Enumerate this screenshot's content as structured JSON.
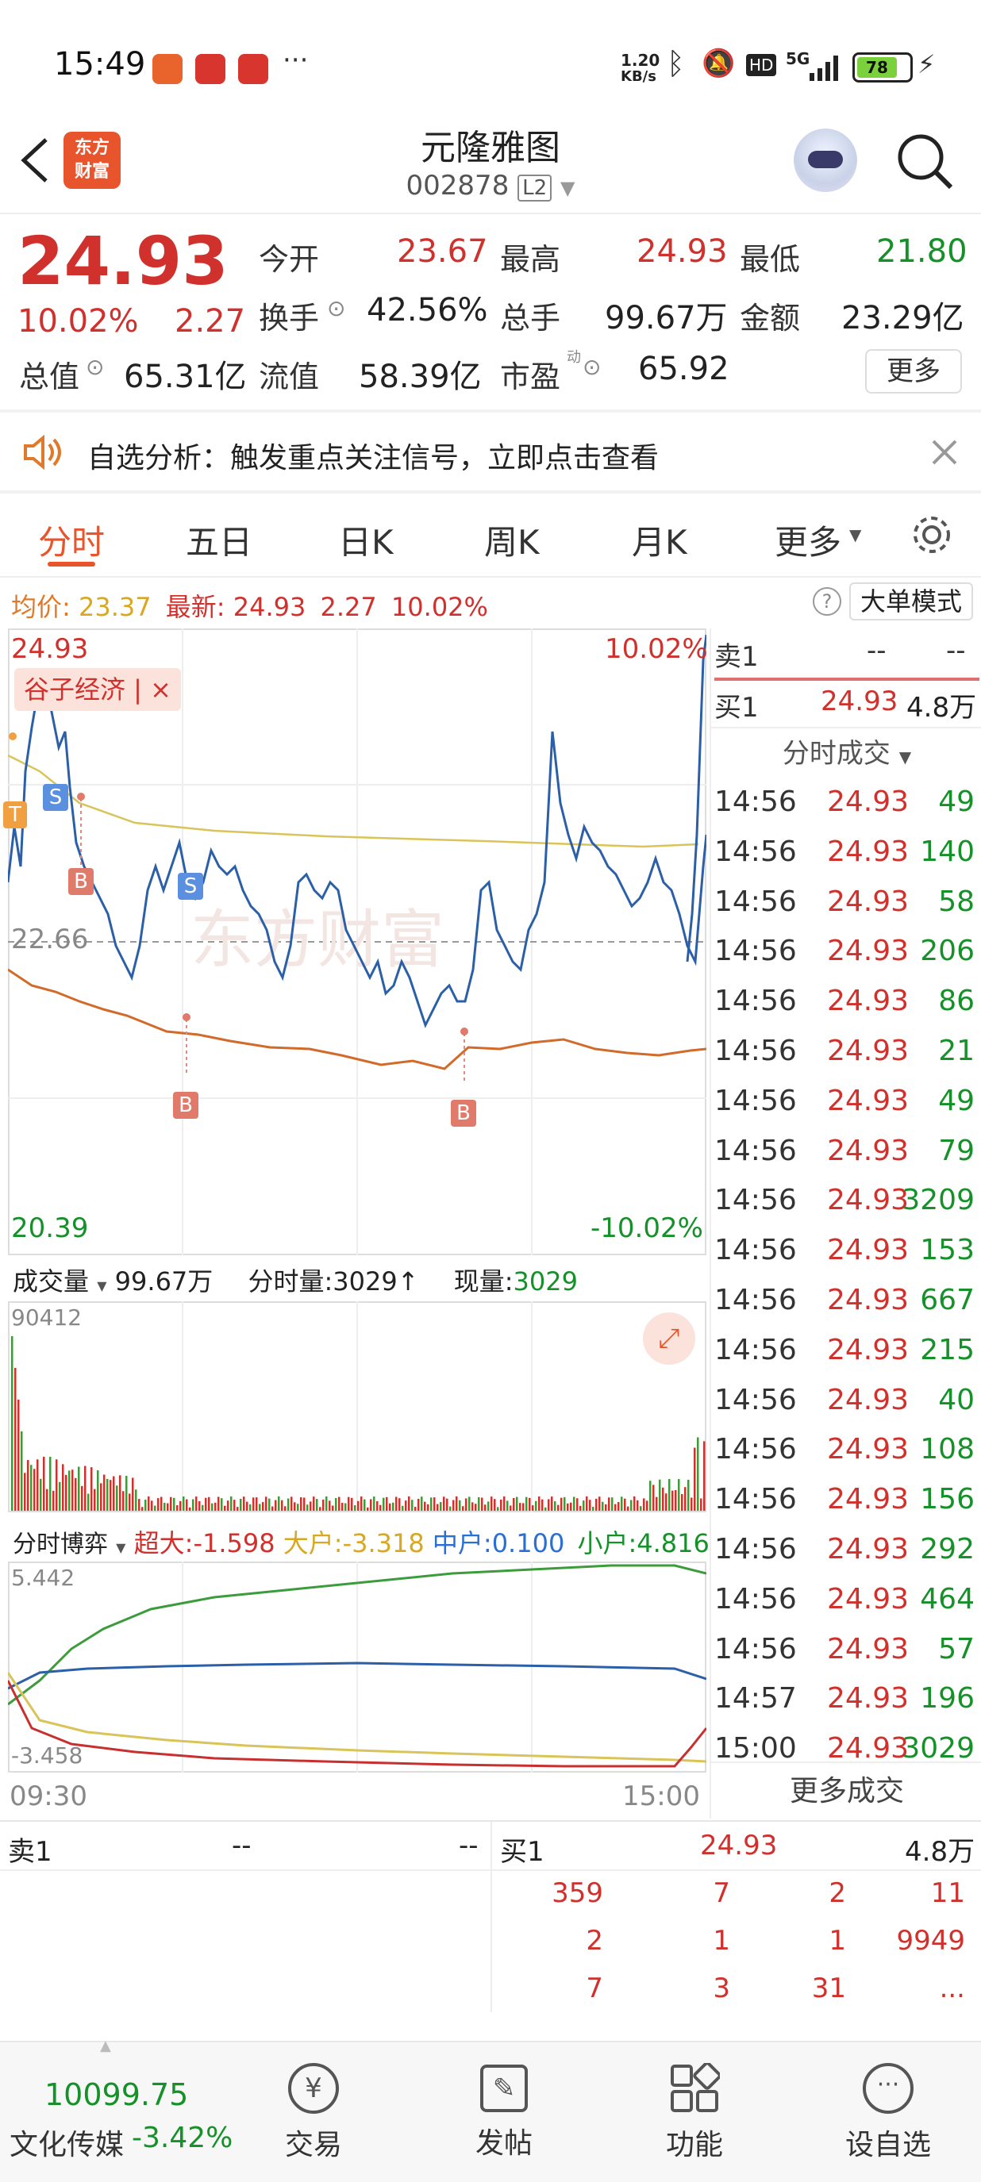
{
  "status": {
    "time": "15:49",
    "net_rate": "1.20",
    "net_unit": "KB/s",
    "battery": "78",
    "signal": "5G"
  },
  "header": {
    "name": "元隆雅图",
    "code": "002878",
    "level": "L2",
    "logo_text_1": "东方",
    "logo_text_2": "财富"
  },
  "quote": {
    "price": "24.93",
    "change_pct": "10.02%",
    "change": "2.27",
    "open_label": "今开",
    "open": "23.67",
    "high_label": "最高",
    "high": "24.93",
    "low_label": "最低",
    "low": "21.80",
    "turnover_label": "换手",
    "turnover": "42.56%",
    "volume_label": "总手",
    "volume": "99.67万",
    "amount_label": "金额",
    "amount": "23.29亿",
    "mktcap_label": "总值",
    "mktcap": "65.31亿",
    "float_label": "流值",
    "float": "58.39亿",
    "pe_label": "市盈",
    "pe_sup": "动",
    "pe": "65.92",
    "more": "更多"
  },
  "notice": {
    "text": "自选分析：触发重点关注信号，立即点击查看"
  },
  "tabs": [
    "分时",
    "五日",
    "日K",
    "周K",
    "月K",
    "更多"
  ],
  "info": {
    "avg_label": "均价:",
    "avg": "23.37",
    "latest_label": "最新:",
    "latest": "24.93",
    "chg": "2.27",
    "pct": "10.02%",
    "big_mode": "大单模式"
  },
  "chart": {
    "ymax": "24.93",
    "ymid": "22.66",
    "ymin": "20.39",
    "pmax": "10.02%",
    "pmin": "-10.02%",
    "tag": "谷子经济 | ×",
    "t_start": "09:30",
    "t_end": "15:00"
  },
  "vol": {
    "label": "成交量",
    "total": "99.67万",
    "seg_label": "分时量:3029",
    "arrow": "↑",
    "now_label": "现量:",
    "now": "3029",
    "max": "90412"
  },
  "flow": {
    "label": "分时博弈",
    "super": "超大:-1.598",
    "large": "大户:-3.318",
    "mid": "中户:0.100",
    "small": "小户:4.816",
    "max": "5.442",
    "min": "-3.458"
  },
  "side_book": {
    "ask_label": "卖1",
    "ask_p": "--",
    "ask_v": "--",
    "bid_label": "买1",
    "bid_p": "24.93",
    "bid_v": "4.8万"
  },
  "ticks_title": "分时成交",
  "ticks": [
    {
      "t": "14:56",
      "p": "24.93",
      "v": "49"
    },
    {
      "t": "14:56",
      "p": "24.93",
      "v": "140"
    },
    {
      "t": "14:56",
      "p": "24.93",
      "v": "58"
    },
    {
      "t": "14:56",
      "p": "24.93",
      "v": "206"
    },
    {
      "t": "14:56",
      "p": "24.93",
      "v": "86"
    },
    {
      "t": "14:56",
      "p": "24.93",
      "v": "21"
    },
    {
      "t": "14:56",
      "p": "24.93",
      "v": "49"
    },
    {
      "t": "14:56",
      "p": "24.93",
      "v": "79"
    },
    {
      "t": "14:56",
      "p": "24.93",
      "v": "3209"
    },
    {
      "t": "14:56",
      "p": "24.93",
      "v": "153"
    },
    {
      "t": "14:56",
      "p": "24.93",
      "v": "667"
    },
    {
      "t": "14:56",
      "p": "24.93",
      "v": "215"
    },
    {
      "t": "14:56",
      "p": "24.93",
      "v": "40"
    },
    {
      "t": "14:56",
      "p": "24.93",
      "v": "108"
    },
    {
      "t": "14:56",
      "p": "24.93",
      "v": "156"
    },
    {
      "t": "14:56",
      "p": "24.93",
      "v": "292"
    },
    {
      "t": "14:56",
      "p": "24.93",
      "v": "464"
    },
    {
      "t": "14:56",
      "p": "24.93",
      "v": "57"
    },
    {
      "t": "14:57",
      "p": "24.93",
      "v": "196"
    },
    {
      "t": "15:00",
      "p": "24.93",
      "v": "3029"
    }
  ],
  "more_ticks": "更多成交",
  "bottom_book": {
    "ask_label": "卖1",
    "ask_p": "--",
    "ask_v": "--",
    "bid_label": "买1",
    "bid_p": "24.93",
    "bid_v": "4.8万",
    "rows": [
      [
        "359",
        "7",
        "2",
        "11"
      ],
      [
        "2",
        "1",
        "1",
        "9949"
      ],
      [
        "7",
        "3",
        "31",
        "..."
      ]
    ]
  },
  "nav": {
    "index_value": "10099.75",
    "index_name": "文化传媒",
    "index_pct": "-3.42%",
    "trade": "交易",
    "post": "发帖",
    "func": "功能",
    "watch": "设自选"
  }
}
